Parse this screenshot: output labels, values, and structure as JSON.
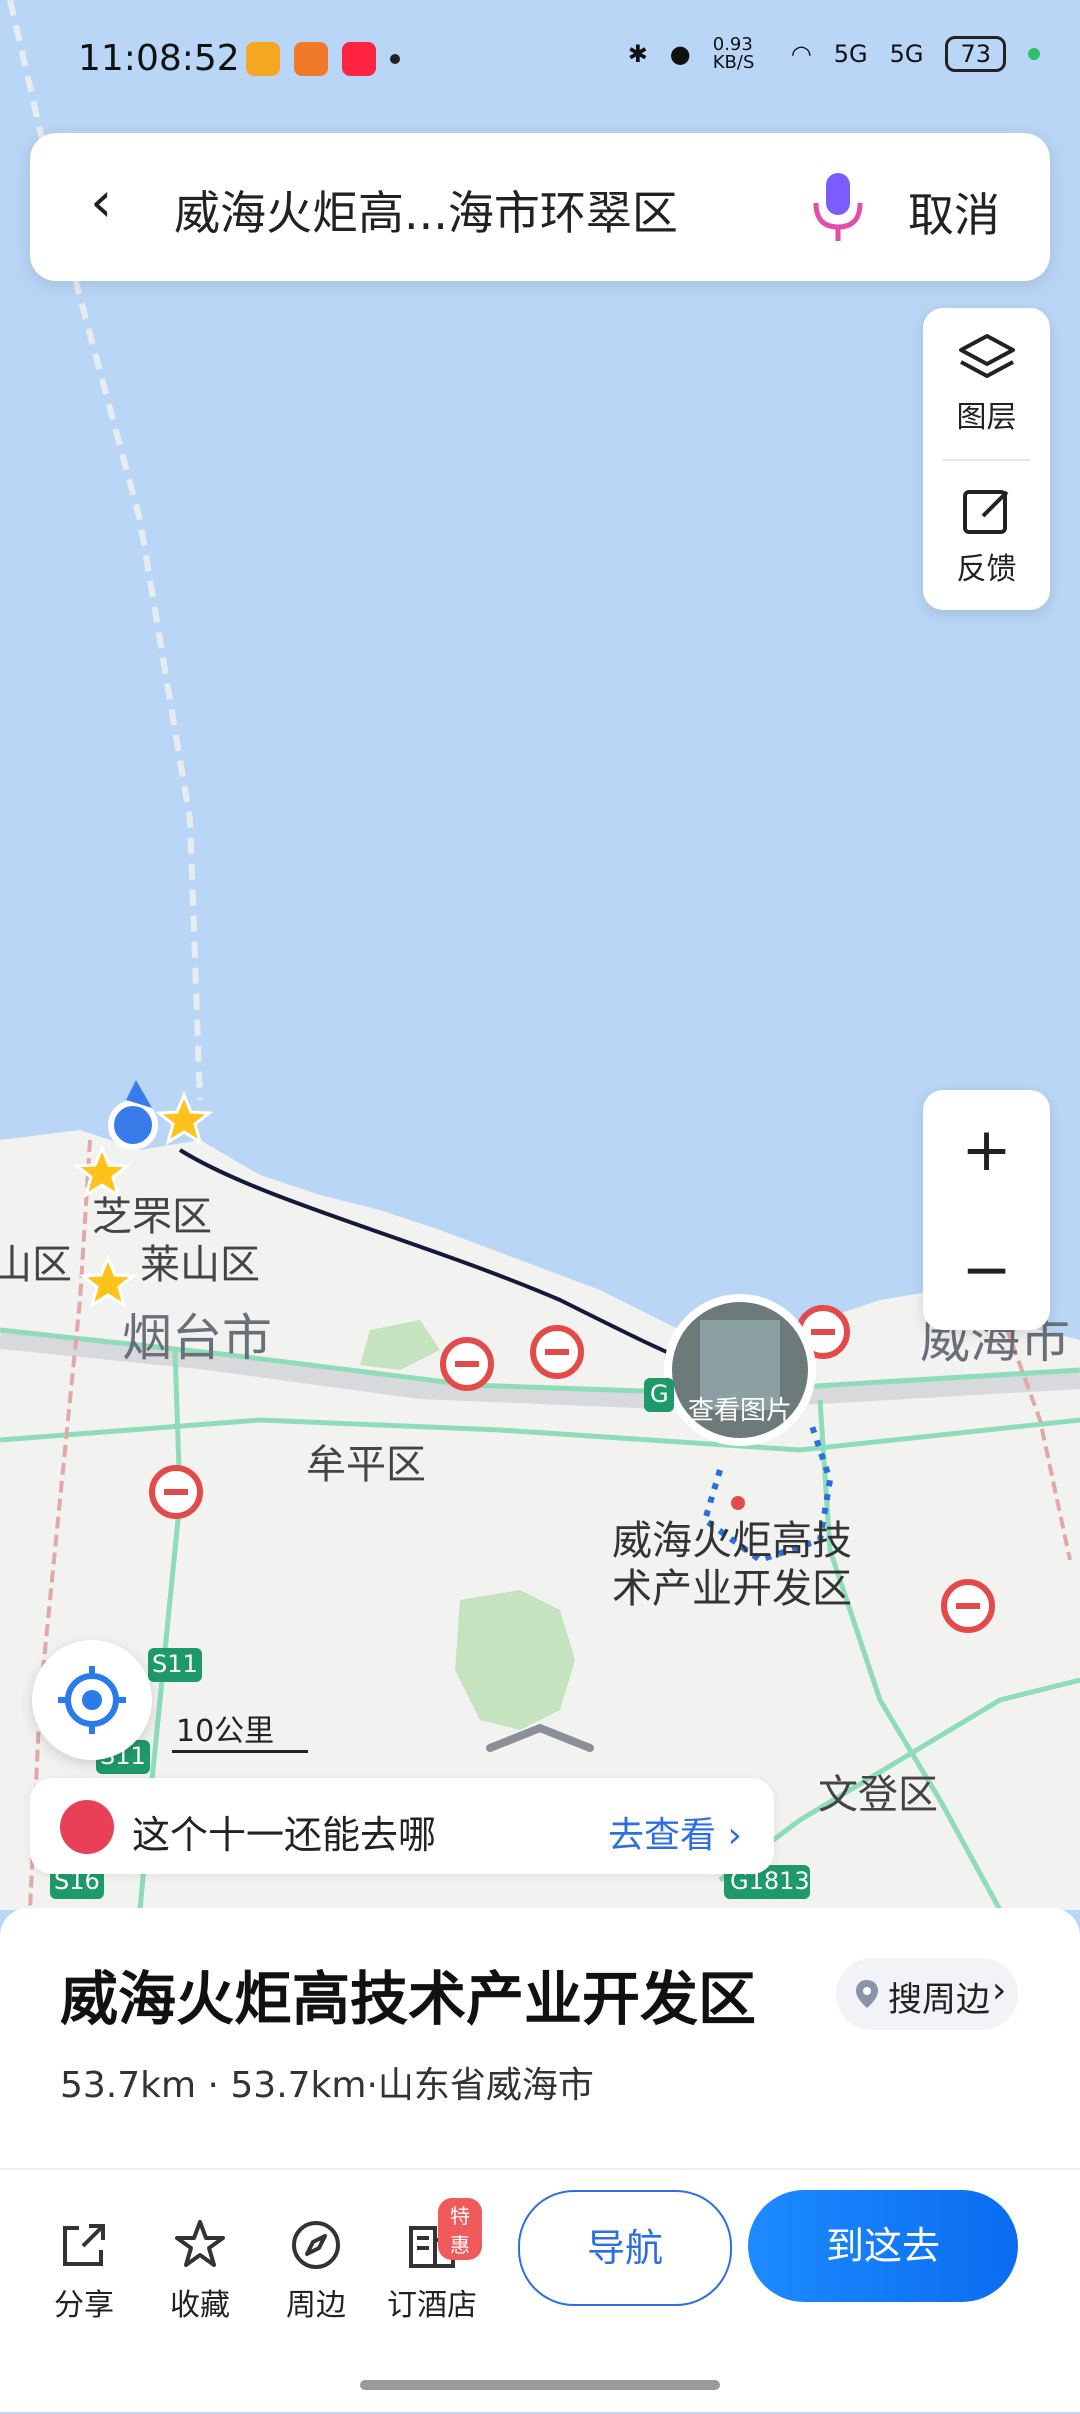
{
  "status_bar": {
    "time": "11:08:52",
    "net_speed": "0.93 KB/S",
    "sig1": "5G",
    "sig2": "5G",
    "battery": "73"
  },
  "search": {
    "query": "威海火炬高...海市环翠区",
    "cancel": "取消"
  },
  "side_tools": {
    "layers": "图层",
    "feedback": "反馈"
  },
  "zoom": {
    "in": "+",
    "out": "−"
  },
  "map": {
    "labels": {
      "zhifu": "芝罘区",
      "laishan": "莱山区",
      "shan": "山区",
      "yantai": "烟台市",
      "muping": "牟平区",
      "weihai": "威海市",
      "wendeng": "文登区",
      "target_line1": "威海火炬高技",
      "target_line2": "术产业开发区",
      "s11a": "S11",
      "s11b": "S11",
      "s16": "S16",
      "g1813": "G1813",
      "g": "G"
    },
    "photo_label": "查看图片",
    "scale": "10公里"
  },
  "banner": {
    "text": "这个十一还能去哪",
    "link": "去查看 ›"
  },
  "place": {
    "title": "威海火炬高技术产业开发区",
    "nearby": "搜周边",
    "address": "53.7km · 53.7km·山东省威海市"
  },
  "actions": {
    "share": "分享",
    "favorite": "收藏",
    "around": "周边",
    "hotel": "订酒店",
    "hotel_badge": "特惠",
    "navigate": "导航",
    "go_here": "到这去"
  }
}
